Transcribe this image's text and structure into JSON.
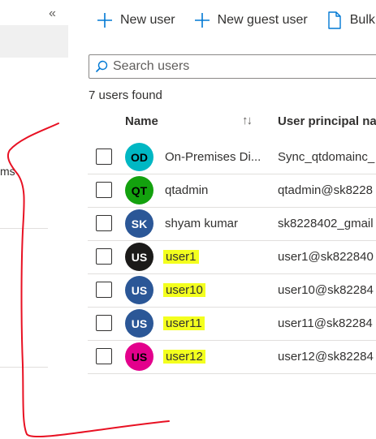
{
  "sidebar": {
    "collapse_glyph": "«",
    "partial_item_text": "ms"
  },
  "toolbar": {
    "new_user": "New user",
    "new_guest_user": "New guest user",
    "bulk": "Bulk"
  },
  "search": {
    "placeholder": "Search users",
    "value": ""
  },
  "results": {
    "count_text": "7 users found"
  },
  "table": {
    "headers": {
      "name": "Name",
      "upn": "User principal na"
    },
    "sort_icon": "sort-arrows-icon",
    "rows": [
      {
        "initials": "OD",
        "color": "#00b7c3",
        "text_color": "dark",
        "name": "On-Premises Di...",
        "upn": "Sync_qtdomainc_",
        "highlight": false
      },
      {
        "initials": "QT",
        "color": "#13a10e",
        "text_color": "dark",
        "name": "qtadmin",
        "upn": "qtadmin@sk8228",
        "highlight": false
      },
      {
        "initials": "SK",
        "color": "#2b5797",
        "text_color": "light",
        "name": "shyam kumar",
        "upn": "sk8228402_gmail",
        "highlight": false
      },
      {
        "initials": "US",
        "color": "#1b1a19",
        "text_color": "light",
        "name": "user1",
        "upn": "user1@sk822840",
        "highlight": true
      },
      {
        "initials": "US",
        "color": "#2b5797",
        "text_color": "light",
        "name": "user10",
        "upn": "user10@sk82284",
        "highlight": true
      },
      {
        "initials": "US",
        "color": "#2b5797",
        "text_color": "light",
        "name": "user11",
        "upn": "user11@sk82284",
        "highlight": true
      },
      {
        "initials": "US",
        "color": "#e3008c",
        "text_color": "dark",
        "name": "user12",
        "upn": "user12@sk82284",
        "highlight": true
      }
    ]
  },
  "colors": {
    "accent": "#0078d4",
    "highlight": "#f3ff1e",
    "annotation": "#e81123"
  }
}
